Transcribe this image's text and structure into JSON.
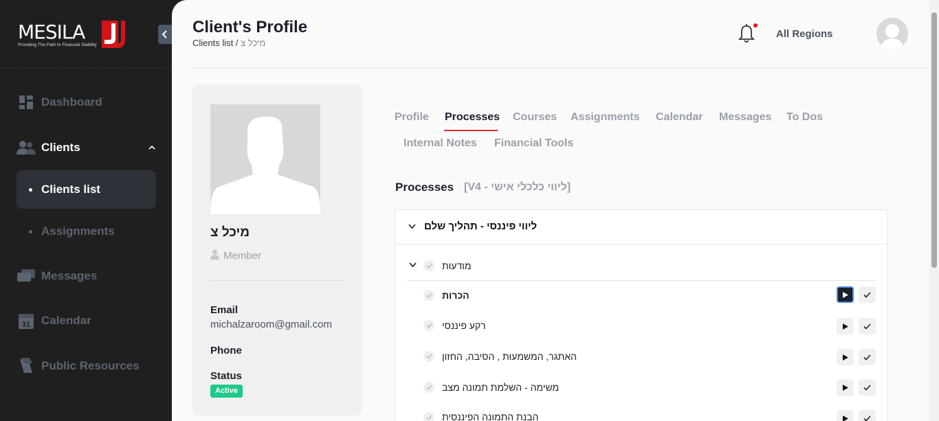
{
  "sidebar": {
    "logo_text": "MESILA",
    "logo_tagline": "Providing The Path to Financial Stability",
    "items": {
      "dashboard": "Dashboard",
      "clients": "Clients",
      "clients_list": "Clients list",
      "assignments": "Assignments",
      "messages": "Messages",
      "calendar": "Calendar",
      "calendar_icon_num": "31",
      "public_resources": "Public Resources"
    }
  },
  "header": {
    "title": "Client's Profile",
    "breadcrumb_parent": "Clients list /",
    "breadcrumb_current": "מיכל צ",
    "region": "All Regions"
  },
  "profile": {
    "name": "מיכל צ",
    "role": "Member",
    "email_label": "Email",
    "email": "michalzaroom@gmail.com",
    "phone_label": "Phone",
    "status_label": "Status",
    "status": "Active"
  },
  "tabs": {
    "profile": "Profile",
    "processes": "Processes",
    "courses": "Courses",
    "assignments": "Assignments",
    "calendar": "Calendar",
    "messages": "Messages",
    "todos": "To Dos",
    "internal_notes": "Internal Notes",
    "financial_tools": "Financial Tools"
  },
  "processes": {
    "title": "Processes",
    "subtitle": "[V4 - ליווי כלכלי אישי]",
    "panel_title": "ליווי פיננסי - תהליך שלם",
    "group": "מודעות",
    "rows": [
      "הכרות",
      "רקע פיננסי",
      "האתגר, המשמעות , הסיבה, החזון",
      "משימה - השלמת תמונה מצב",
      "הבנת התמונה הפיננסית"
    ]
  },
  "colors": {
    "accent_red": "#d0312d",
    "status_green": "#1ec98a",
    "sidebar_bg": "#1f1f1f"
  }
}
